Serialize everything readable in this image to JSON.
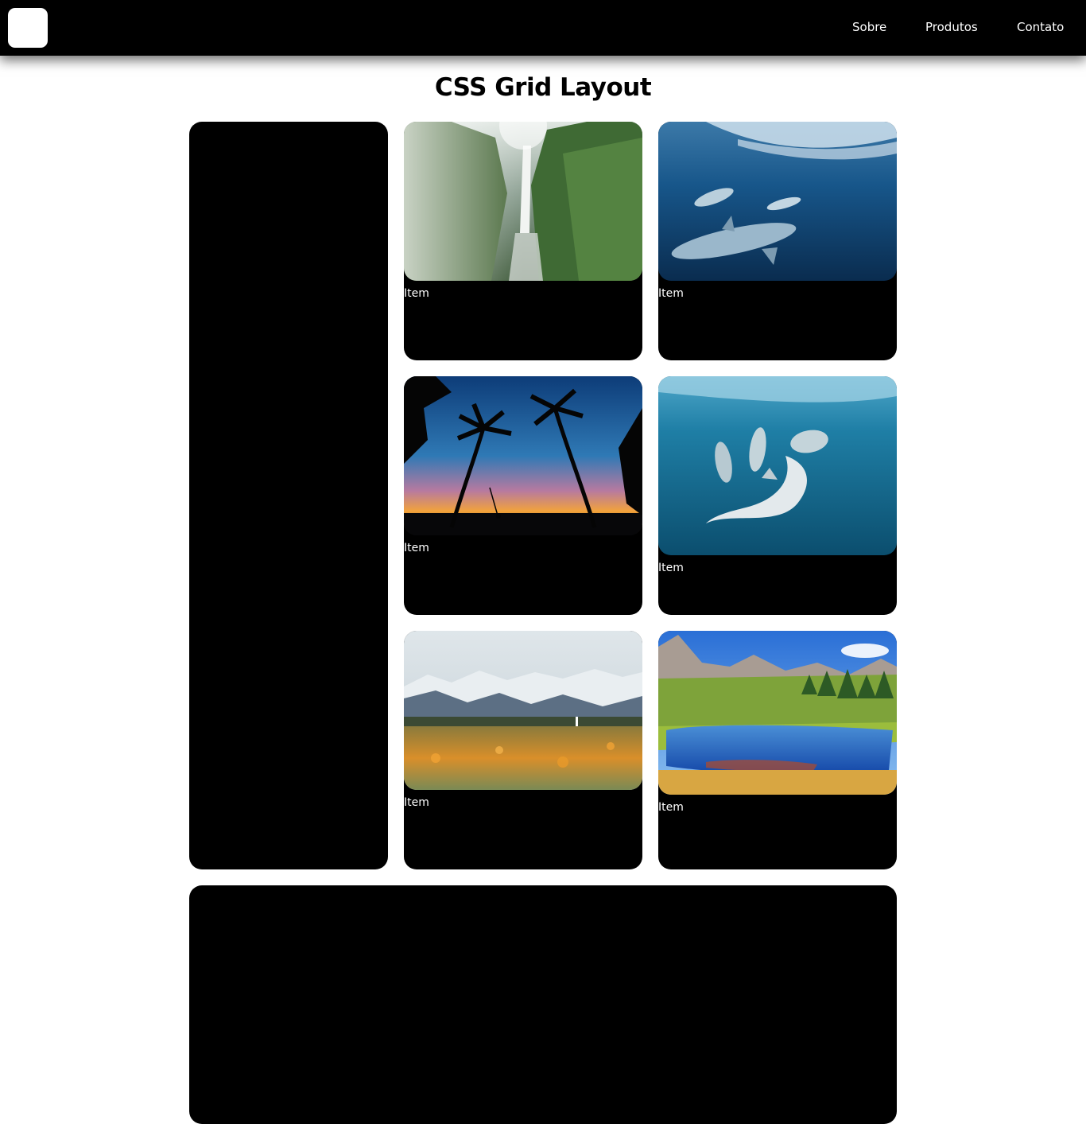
{
  "navbar": {
    "logo": "white-square-logo",
    "links": [
      "Sobre",
      "Produtos",
      "Contato"
    ]
  },
  "page": {
    "title": "CSS Grid Layout"
  },
  "grid": {
    "items": [
      {
        "caption": "Item",
        "image": "misty-jungle-waterfall"
      },
      {
        "caption": "Item",
        "image": "dolphins-underwater-blue"
      },
      {
        "caption": "Item",
        "image": "palm-trees-sunset-swing"
      },
      {
        "caption": "Item",
        "image": "dolphin-pod-turquoise-sea"
      },
      {
        "caption": "Item",
        "image": "snowy-mountains-flower-field"
      },
      {
        "caption": "Item",
        "image": "alpine-lake-reflection"
      }
    ]
  },
  "colors": {
    "navbar": "#000000",
    "card": "#000000",
    "background": "#ffffff",
    "text_light": "#ffffff",
    "text_dark": "#000000"
  }
}
